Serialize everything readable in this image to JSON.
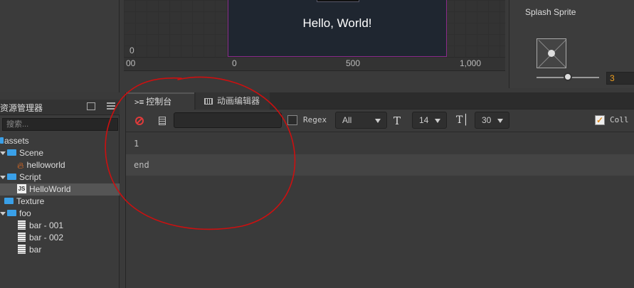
{
  "scene": {
    "canvas_text": "Hello, World!",
    "ruler": {
      "y_zero": "0",
      "x_labels": [
        "00",
        "0",
        "500",
        "1,000"
      ]
    }
  },
  "inspector": {
    "splash_label": "Splash Sprite",
    "slider_value": "3"
  },
  "assets": {
    "title": "资源管理器",
    "search_placeholder": "搜索...",
    "tree": [
      {
        "label": "assets",
        "type": "root"
      },
      {
        "label": "Scene",
        "type": "folder"
      },
      {
        "label": "helloworld",
        "type": "fire"
      },
      {
        "label": "Script",
        "type": "folder"
      },
      {
        "label": "HelloWorld",
        "type": "js"
      },
      {
        "label": "Texture",
        "type": "folder"
      },
      {
        "label": "foo",
        "type": "folder"
      },
      {
        "label": "bar - 001",
        "type": "file"
      },
      {
        "label": "bar - 002",
        "type": "file"
      },
      {
        "label": "bar",
        "type": "file"
      }
    ]
  },
  "console": {
    "tabs": [
      {
        "label": "控制台",
        "icon": "terminal-icon"
      },
      {
        "label": "动画编辑器",
        "icon": "animation-icon"
      }
    ],
    "regex_label": "Regex",
    "level_select": "All",
    "font_size_select": "14",
    "line_height_select": "30",
    "collapse_label": "Coll",
    "logs": [
      "1",
      "end"
    ]
  },
  "colors": {
    "accent": "#e08a20",
    "annotation": "#cc1010",
    "canvas_border": "#8a2a8a"
  }
}
